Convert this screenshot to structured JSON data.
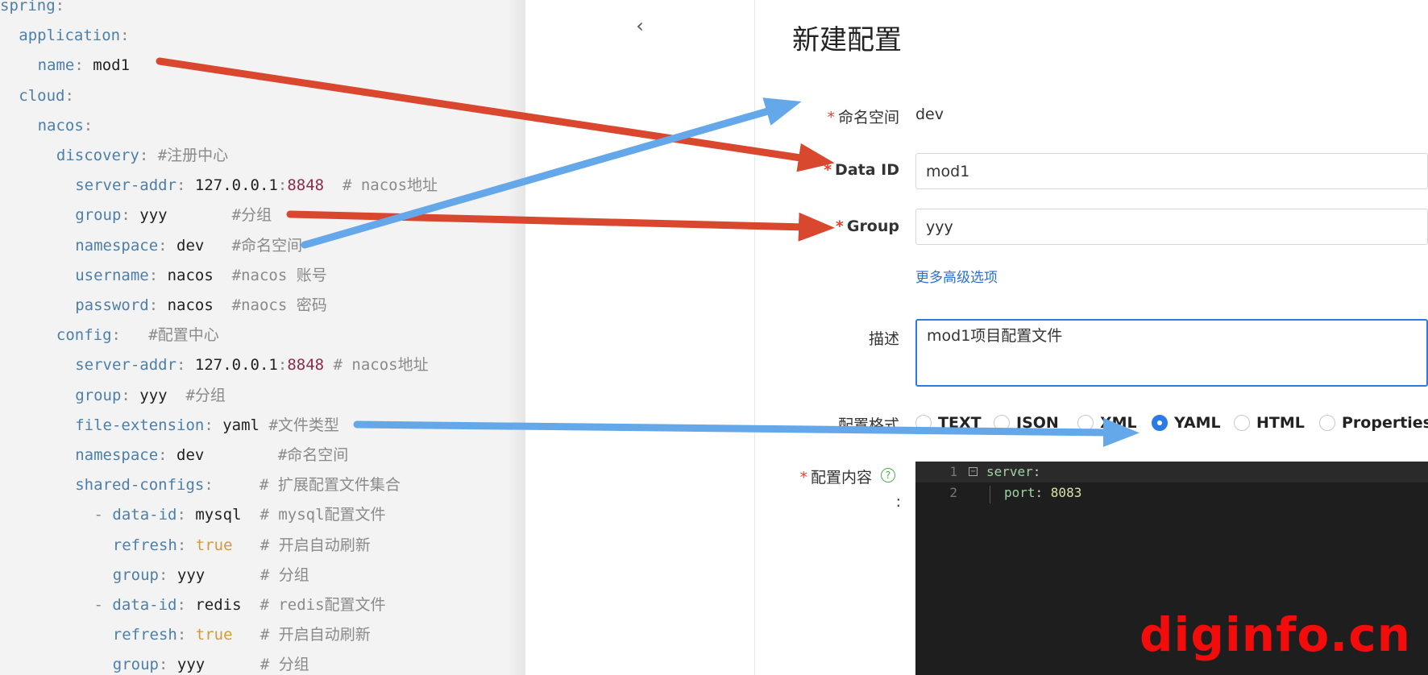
{
  "yaml_lines": [
    {
      "indent": 0,
      "parts": [
        {
          "t": "spring",
          "c": "k"
        },
        {
          "t": ":",
          "c": "p"
        }
      ]
    },
    {
      "indent": 1,
      "parts": [
        {
          "t": "application",
          "c": "k"
        },
        {
          "t": ":",
          "c": "p"
        }
      ]
    },
    {
      "indent": 2,
      "parts": [
        {
          "t": "name",
          "c": "k"
        },
        {
          "t": ": ",
          "c": "p"
        },
        {
          "t": "mod1",
          "c": "v"
        }
      ]
    },
    {
      "indent": 1,
      "parts": [
        {
          "t": "cloud",
          "c": "k"
        },
        {
          "t": ":",
          "c": "p"
        }
      ]
    },
    {
      "indent": 2,
      "parts": [
        {
          "t": "nacos",
          "c": "k"
        },
        {
          "t": ":",
          "c": "p"
        }
      ]
    },
    {
      "indent": 3,
      "parts": [
        {
          "t": "discovery",
          "c": "k"
        },
        {
          "t": ": ",
          "c": "p"
        },
        {
          "t": "#注册中心",
          "c": "c"
        }
      ]
    },
    {
      "indent": 4,
      "parts": [
        {
          "t": "server-addr",
          "c": "k"
        },
        {
          "t": ": ",
          "c": "p"
        },
        {
          "t": "127.0.0.1",
          "c": "v"
        },
        {
          "t": ":",
          "c": "p"
        },
        {
          "t": "8848",
          "c": "n"
        },
        {
          "t": "  # nacos地址",
          "c": "c"
        }
      ]
    },
    {
      "indent": 4,
      "parts": [
        {
          "t": "group",
          "c": "k"
        },
        {
          "t": ": ",
          "c": "p"
        },
        {
          "t": "yyy",
          "c": "v"
        },
        {
          "t": "       #分组",
          "c": "c"
        }
      ]
    },
    {
      "indent": 4,
      "parts": [
        {
          "t": "namespace",
          "c": "k"
        },
        {
          "t": ": ",
          "c": "p"
        },
        {
          "t": "dev",
          "c": "v"
        },
        {
          "t": "   #命名空间",
          "c": "c"
        }
      ]
    },
    {
      "indent": 4,
      "parts": [
        {
          "t": "username",
          "c": "k"
        },
        {
          "t": ": ",
          "c": "p"
        },
        {
          "t": "nacos",
          "c": "v"
        },
        {
          "t": "  #nacos 账号",
          "c": "c"
        }
      ]
    },
    {
      "indent": 4,
      "parts": [
        {
          "t": "password",
          "c": "k"
        },
        {
          "t": ": ",
          "c": "p"
        },
        {
          "t": "nacos",
          "c": "v"
        },
        {
          "t": "  #naocs 密码",
          "c": "c"
        }
      ]
    },
    {
      "indent": 3,
      "parts": [
        {
          "t": "config",
          "c": "k"
        },
        {
          "t": ":",
          "c": "p"
        },
        {
          "t": "   #配置中心",
          "c": "c"
        }
      ]
    },
    {
      "indent": 4,
      "parts": [
        {
          "t": "server-addr",
          "c": "k"
        },
        {
          "t": ": ",
          "c": "p"
        },
        {
          "t": "127.0.0.1",
          "c": "v"
        },
        {
          "t": ":",
          "c": "p"
        },
        {
          "t": "8848",
          "c": "n"
        },
        {
          "t": " # nacos地址",
          "c": "c"
        }
      ]
    },
    {
      "indent": 4,
      "parts": [
        {
          "t": "group",
          "c": "k"
        },
        {
          "t": ": ",
          "c": "p"
        },
        {
          "t": "yyy",
          "c": "v"
        },
        {
          "t": "  #分组",
          "c": "c"
        }
      ]
    },
    {
      "indent": 4,
      "parts": [
        {
          "t": "file-extension",
          "c": "k"
        },
        {
          "t": ": ",
          "c": "p"
        },
        {
          "t": "yaml",
          "c": "v"
        },
        {
          "t": " #文件类型",
          "c": "c"
        }
      ]
    },
    {
      "indent": 4,
      "parts": [
        {
          "t": "namespace",
          "c": "k"
        },
        {
          "t": ": ",
          "c": "p"
        },
        {
          "t": "dev",
          "c": "v"
        },
        {
          "t": "        #命名空间",
          "c": "c"
        }
      ]
    },
    {
      "indent": 4,
      "parts": [
        {
          "t": "shared-configs",
          "c": "k"
        },
        {
          "t": ":",
          "c": "p"
        },
        {
          "t": "     # 扩展配置文件集合",
          "c": "c"
        }
      ]
    },
    {
      "indent": 5,
      "parts": [
        {
          "t": "- ",
          "c": "p"
        },
        {
          "t": "data-id",
          "c": "k"
        },
        {
          "t": ": ",
          "c": "p"
        },
        {
          "t": "mysql",
          "c": "v"
        },
        {
          "t": "  # mysql配置文件",
          "c": "c"
        }
      ]
    },
    {
      "indent": 6,
      "parts": [
        {
          "t": "refresh",
          "c": "k"
        },
        {
          "t": ": ",
          "c": "p"
        },
        {
          "t": "true",
          "c": "b"
        },
        {
          "t": "   # 开启自动刷新",
          "c": "c"
        }
      ]
    },
    {
      "indent": 6,
      "parts": [
        {
          "t": "group",
          "c": "k"
        },
        {
          "t": ": ",
          "c": "p"
        },
        {
          "t": "yyy",
          "c": "v"
        },
        {
          "t": "      # 分组",
          "c": "c"
        }
      ]
    },
    {
      "indent": 5,
      "parts": [
        {
          "t": "- ",
          "c": "p"
        },
        {
          "t": "data-id",
          "c": "k"
        },
        {
          "t": ": ",
          "c": "p"
        },
        {
          "t": "redis",
          "c": "v"
        },
        {
          "t": "  # redis配置文件",
          "c": "c"
        }
      ]
    },
    {
      "indent": 6,
      "parts": [
        {
          "t": "refresh",
          "c": "k"
        },
        {
          "t": ": ",
          "c": "p"
        },
        {
          "t": "true",
          "c": "b"
        },
        {
          "t": "   # 开启自动刷新",
          "c": "c"
        }
      ]
    },
    {
      "indent": 6,
      "parts": [
        {
          "t": "group",
          "c": "k"
        },
        {
          "t": ": ",
          "c": "p"
        },
        {
          "t": "yyy",
          "c": "v"
        },
        {
          "t": "      # 分组",
          "c": "c"
        }
      ]
    }
  ],
  "form": {
    "back_icon": "chevron-left-icon",
    "title": "新建配置",
    "namespace": {
      "label": "命名空间",
      "value": "dev"
    },
    "data_id": {
      "label": "Data ID",
      "value": "mod1"
    },
    "group": {
      "label": "Group",
      "value": "yyy"
    },
    "advanced_link": "更多高级选项",
    "description": {
      "label": "描述",
      "value": "mod1项目配置文件"
    },
    "format": {
      "label": "配置格式",
      "options": [
        "TEXT",
        "JSON",
        "XML",
        "YAML",
        "HTML",
        "Properties"
      ],
      "selected": "YAML"
    },
    "content": {
      "label": "配置内容",
      "colon": ":",
      "help_icon": "question-circle-icon",
      "lines": [
        {
          "num": "1",
          "key": "server",
          "sep": ":",
          "value": ""
        },
        {
          "num": "2",
          "key": "port",
          "sep": ": ",
          "value": "8083"
        }
      ]
    }
  },
  "watermark": "diginfo.cn",
  "colors": {
    "arrow_red": "#d9472f",
    "arrow_blue": "#64a8ea",
    "accent": "#2c7be5",
    "required": "#e0432f",
    "watermark": "#f20c0c"
  }
}
